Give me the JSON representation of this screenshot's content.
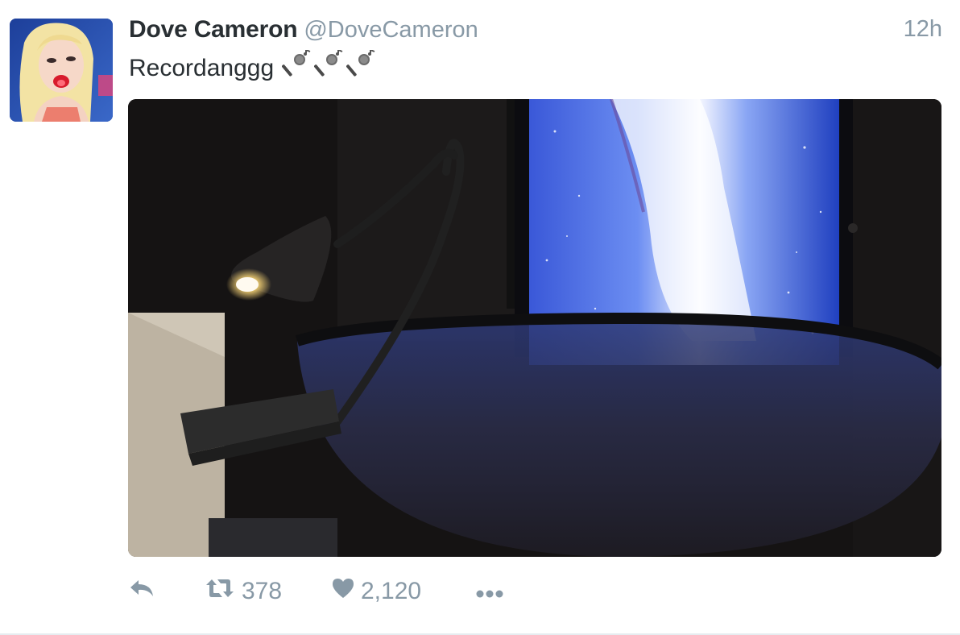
{
  "user": {
    "display_name": "Dove Cameron",
    "handle": "@DoveCameron",
    "avatar_icon": "profile-photo"
  },
  "tweet": {
    "timestamp": "12h",
    "text": "Recordanggg",
    "emoji": [
      "microphone",
      "microphone",
      "microphone"
    ]
  },
  "media": {
    "kind": "photo",
    "subject": "desk lamp, pop filter and monitor with galaxy wallpaper"
  },
  "actions": {
    "reply_icon": "reply-icon",
    "retweet_icon": "retweet-icon",
    "retweet_count": "378",
    "like_icon": "heart-icon",
    "like_count": "2,120",
    "more_icon": "more-icon"
  },
  "colors": {
    "name": "#292f33",
    "muted": "#8899a6",
    "divider": "#e6ecf0"
  }
}
